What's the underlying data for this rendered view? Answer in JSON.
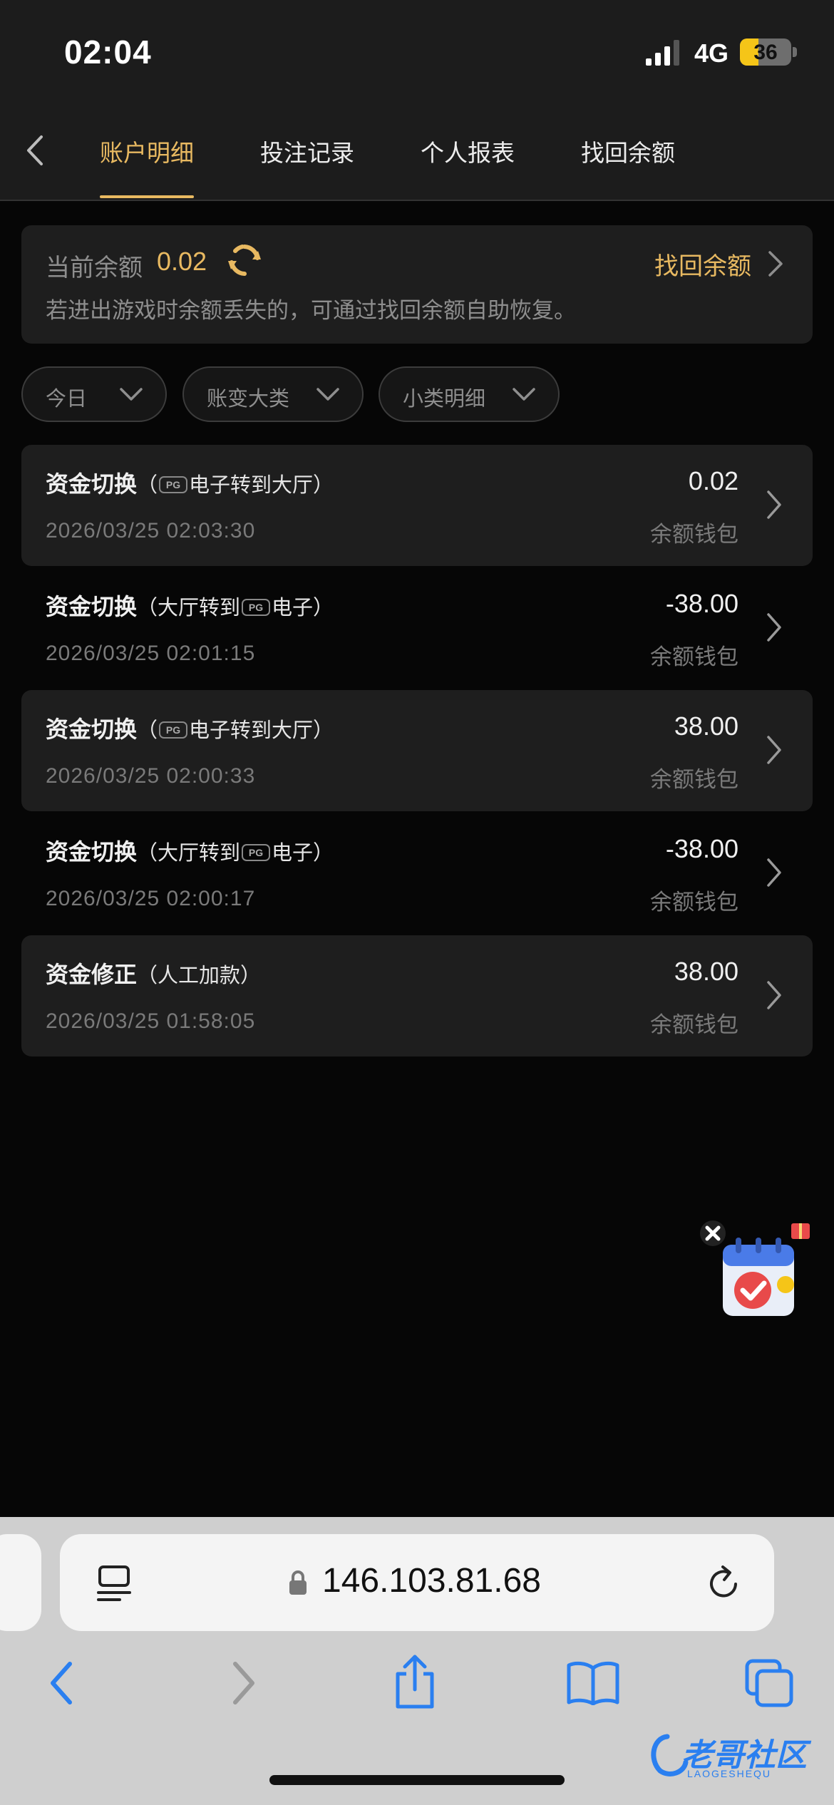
{
  "status_bar": {
    "time": "02:04",
    "network": "4G",
    "battery": "36",
    "battery_level": 0.36
  },
  "tabs": [
    {
      "label": "账户明细",
      "active": true
    },
    {
      "label": "投注记录",
      "active": false
    },
    {
      "label": "个人报表",
      "active": false
    },
    {
      "label": "找回余额",
      "active": false
    }
  ],
  "balance": {
    "label": "当前余额",
    "value": "0.02",
    "recover_label": "找回余额",
    "hint": "若进出游戏时余额丢失的，可通过找回余额自助恢复。"
  },
  "filters": [
    {
      "label": "今日"
    },
    {
      "label": "账变大类"
    },
    {
      "label": "小类明细"
    }
  ],
  "records": [
    {
      "type": "资金切换",
      "detail_pre": "（",
      "detail_post": "电子转到大厅）",
      "pg_first": true,
      "amount": "0.02",
      "wallet": "余额钱包",
      "date": "2026/03/25 02:03:30"
    },
    {
      "type": "资金切换",
      "detail_pre": "（大厅转到",
      "detail_post": "电子）",
      "pg_first": false,
      "amount": "-38.00",
      "wallet": "余额钱包",
      "date": "2026/03/25 02:01:15"
    },
    {
      "type": "资金切换",
      "detail_pre": "（",
      "detail_post": "电子转到大厅）",
      "pg_first": true,
      "amount": "38.00",
      "wallet": "余额钱包",
      "date": "2026/03/25 02:00:33"
    },
    {
      "type": "资金切换",
      "detail_pre": "（大厅转到",
      "detail_post": "电子）",
      "pg_first": false,
      "amount": "-38.00",
      "wallet": "余额钱包",
      "date": "2026/03/25 02:00:17"
    },
    {
      "type": "资金修正",
      "detail_pre": "（人工加款）",
      "detail_post": "",
      "pg_first": false,
      "no_pg": true,
      "amount": "38.00",
      "wallet": "余额钱包",
      "date": "2026/03/25 01:58:05"
    }
  ],
  "browser": {
    "url": "146.103.81.68"
  },
  "watermark": {
    "text": "老哥社区",
    "sub": "LAOGESHEQU"
  },
  "colors": {
    "accent": "#e8b961",
    "background": "#060606",
    "card": "#1e1e1e",
    "muted": "#8e8e8e",
    "link_blue": "#2a7ff0"
  },
  "icons": [
    "back-chevron-icon",
    "refresh-icon",
    "chevron-right-icon",
    "chevron-down-icon",
    "pg-logo-icon",
    "calendar-checkin-icon",
    "close-icon",
    "gift-icon",
    "reader-mode-icon",
    "lock-icon",
    "reload-icon",
    "browser-back-icon",
    "browser-forward-icon",
    "share-icon",
    "bookmarks-icon",
    "tabs-icon"
  ]
}
